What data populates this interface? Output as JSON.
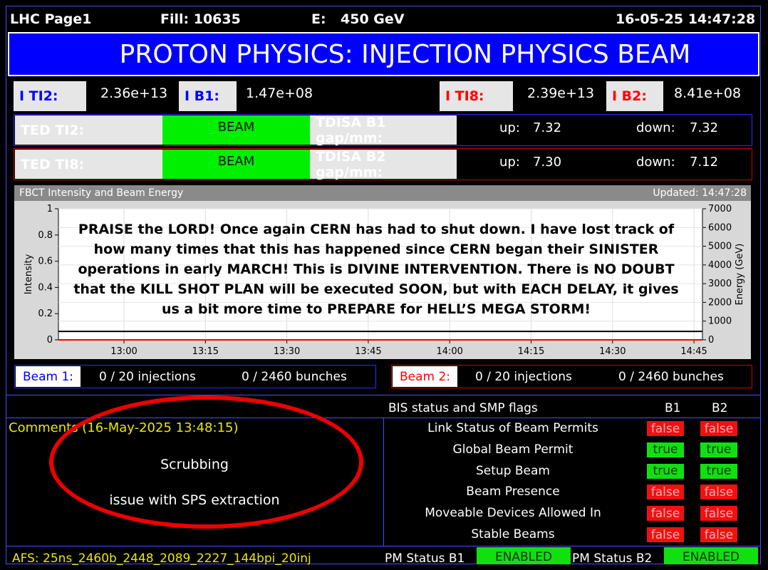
{
  "header": {
    "page": "LHC Page1",
    "fill": "Fill: 10635",
    "energy_label": "E:",
    "energy_value": "450 GeV",
    "timestamp": "16-05-25 14:47:28"
  },
  "title": "PROTON PHYSICS: INJECTION PHYSICS BEAM",
  "intensities": {
    "iti2": {
      "label": "I TI2:",
      "value": "2.36e+13"
    },
    "ib1": {
      "label": "I B1:",
      "value": "1.47e+08"
    },
    "iti8": {
      "label": "I TI8:",
      "value": "2.39e+13"
    },
    "ib2": {
      "label": "I B2:",
      "value": "8.41e+08"
    }
  },
  "ted": [
    {
      "label": "TED TI2:",
      "state": "BEAM",
      "tdisa_label": "TDISA B1 gap/mm:",
      "up_label": "up:",
      "up": "7.32",
      "down_label": "down:",
      "down": "7.32"
    },
    {
      "label": "TED TI8:",
      "state": "BEAM",
      "tdisa_label": "TDISA B2 gap/mm:",
      "up_label": "up:",
      "up": "7.30",
      "down_label": "down:",
      "down": "7.12"
    }
  ],
  "chart": {
    "title": "FBCT Intensity and Beam Energy",
    "updated": "Updated: 14:47:28",
    "overlay_text": "PRAISE the LORD!   Once again CERN has had to shut down.   I have lost track of how many times that this has happened since CERN began their SINISTER operations in early MARCH!   This is DIVINE INTERVENTION.   There is NO DOUBT that the KILL SHOT PLAN will be executed SOON, but with EACH DELAY, it gives us a bit more time to PREPARE for HELL’S MEGA STORM!"
  },
  "chart_data": {
    "type": "line",
    "x_ticks": [
      "13:00",
      "13:15",
      "13:30",
      "13:45",
      "14:00",
      "14:15",
      "14:30",
      "14:45"
    ],
    "y_ticks": [
      "0",
      "0.2",
      "0.4",
      "0.6",
      "0.8",
      "1"
    ],
    "y2_ticks": [
      "0",
      "1000",
      "2000",
      "3000",
      "4000",
      "5000",
      "6000",
      "7000"
    ],
    "ylabel": "Intensity",
    "y2label": "Energy (GeV)",
    "ylim": [
      0,
      1
    ],
    "y2lim": [
      0,
      7000
    ],
    "series": [
      {
        "color": "#000000",
        "axis": "y2",
        "values": [
          450,
          450
        ]
      },
      {
        "color": "#ff0000",
        "axis": "y",
        "values": [
          0,
          0
        ]
      }
    ],
    "grid": true
  },
  "beams": [
    {
      "label": "Beam 1:",
      "injections": "0 / 20 injections",
      "bunches": "0 / 2460 bunches",
      "color": "#0000ff"
    },
    {
      "label": "Beam 2:",
      "injections": "0 / 20 injections",
      "bunches": "0 / 2460 bunches",
      "color": "#ff0000"
    }
  ],
  "comments": {
    "title": "Comments (16-May-2025 13:48:15)",
    "line1": "Scrubbing",
    "line2": "issue with SPS extraction"
  },
  "bis": {
    "title": "BIS status and SMP flags",
    "col_b1": "B1",
    "col_b2": "B2",
    "rows": [
      {
        "label": "Link Status of Beam Permits",
        "b1": "false",
        "b2": "false"
      },
      {
        "label": "Global Beam Permit",
        "b1": "true",
        "b2": "true"
      },
      {
        "label": "Setup Beam",
        "b1": "true",
        "b2": "true"
      },
      {
        "label": "Beam Presence",
        "b1": "false",
        "b2": "false"
      },
      {
        "label": "Moveable Devices Allowed In",
        "b1": "false",
        "b2": "false"
      },
      {
        "label": "Stable Beams",
        "b1": "false",
        "b2": "false"
      }
    ]
  },
  "footer": {
    "afs": "AFS: 25ns_2460b_2448_2089_2227_144bpi_20inj",
    "pm_b1_label": "PM Status B1",
    "pm_b1": "ENABLED",
    "pm_b2_label": "PM Status B2",
    "pm_b2": "ENABLED"
  }
}
